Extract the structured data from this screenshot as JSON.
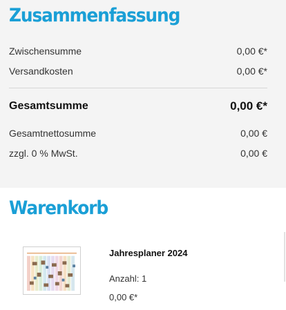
{
  "summary": {
    "title": "Zusammenfassung",
    "subtotal": {
      "label": "Zwischensumme",
      "value": "0,00 €*"
    },
    "shipping": {
      "label": "Versandkosten",
      "value": "0,00 €*"
    },
    "total": {
      "label": "Gesamtsumme",
      "value": "0,00 €*"
    },
    "net_total": {
      "label": "Gesamtnettosumme",
      "value": "0,00 €"
    },
    "vat": {
      "label": "zzgl. 0 % MwSt.",
      "value": "0,00 €"
    }
  },
  "cart": {
    "title": "Warenkorb",
    "items": [
      {
        "name": "Jahresplaner 2024",
        "quantity": "Anzahl: 1",
        "price": "0,00 €*",
        "thumbnail": "calendar-planner-image"
      }
    ]
  },
  "colors": {
    "heading": "#1a9fd6",
    "summary_background": "#f4f4f4"
  }
}
